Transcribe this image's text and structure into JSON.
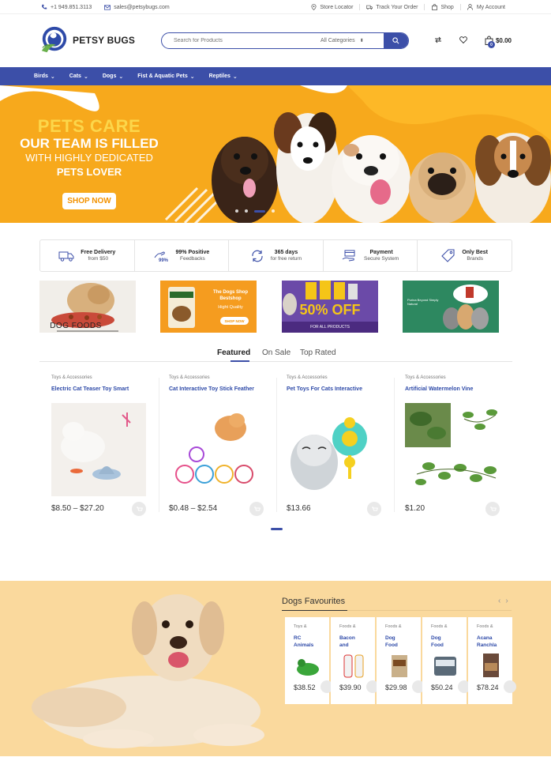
{
  "topbar": {
    "phone": "+1 949.851.3113",
    "email": "sales@petsybugs.com",
    "links": [
      "Store Locator",
      "Track Your Order",
      "Shop",
      "My Account"
    ]
  },
  "header": {
    "logo_text": "PETSY BUGS",
    "search_placeholder": "Search for Products",
    "category_select": "All Categories",
    "cart_total": "$0.00",
    "cart_count": "0"
  },
  "nav": {
    "items": [
      "Birds",
      "Cats",
      "Dogs",
      "Fist & Aquatic Pets",
      "Reptiles"
    ]
  },
  "hero": {
    "line1": "PETS CARE",
    "line2": "OUR TEAM IS FILLED",
    "line3": "WITH HIGHLY DEDICATED",
    "line4": "PETS LOVER",
    "button": "SHOP NOW",
    "slide_count": 4,
    "active_slide": 3
  },
  "features": [
    {
      "title": "Free Delivery",
      "sub": "from $50",
      "icon": "truck-icon"
    },
    {
      "title": "99% Positive",
      "sub": "Feedbacks",
      "icon": "hand-thumb-icon"
    },
    {
      "title": "365 days",
      "sub": "for free return",
      "icon": "refresh-icon"
    },
    {
      "title": "Payment",
      "sub": "Secure System",
      "icon": "payment-hand-icon"
    },
    {
      "title": "Only Best",
      "sub": "Brands",
      "icon": "tag-icon"
    }
  ],
  "banners": {
    "b1_text": "DOG FOODS",
    "b2_title": "The Dogs Shop",
    "b2_sub": "Bestshop",
    "b2_quality": "Hight Quality",
    "b2_btn": "SHOP NOW",
    "b3_big": "50% OFF",
    "b3_sub": "FOR ALL PRODUCTS",
    "b4_text": "Purina Beyond Simply Natural"
  },
  "tabs": [
    "Featured",
    "On Sale",
    "Top Rated"
  ],
  "products": [
    {
      "category": "Toys & Accessories",
      "title": "Electric Cat Teaser Toy Smart",
      "price": "$8.50 – $27.20"
    },
    {
      "category": "Toys & Accessories",
      "title": "Cat Interactive Toy Stick Feather",
      "price": "$0.48 – $2.54"
    },
    {
      "category": "Toys & Accessories",
      "title": "Pet Toys For Cats Interactive",
      "price": "$13.66"
    },
    {
      "category": "Toys & Accessories",
      "title": "Artificial Watermelon Vine",
      "price": "$1.20"
    }
  ],
  "dogs_favourites": {
    "title": "Dogs Favourites",
    "items": [
      {
        "category": "Toys &",
        "title": "RC\nAnimals",
        "price": "$38.52"
      },
      {
        "category": "Foods &",
        "title": "Bacon\nand",
        "price": "$39.90"
      },
      {
        "category": "Foods &",
        "title": "Dog\nFood",
        "price": "$29.98"
      },
      {
        "category": "Foods &",
        "title": "Dog\nFood",
        "price": "$50.24"
      },
      {
        "category": "Foods &",
        "title": "Acana\nRanchla",
        "price": "$78.24"
      }
    ]
  },
  "colors": {
    "brand_blue": "#3c4fa8",
    "hero_orange": "#f7a91c",
    "section_bg": "#fad99d"
  }
}
